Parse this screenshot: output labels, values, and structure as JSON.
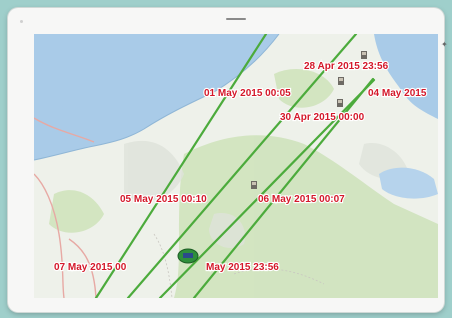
{
  "map": {
    "track_color": "#4cab3c",
    "label_color": "#d4182a",
    "water_color": "#a9cbe8",
    "land_color": "#eef1ea",
    "forest_color": "#c9dfb8",
    "labels": [
      "28 Apr 2015 23:56",
      "01 May 2015 00:05",
      "04 May 2015",
      "30 Apr 2015 00:00",
      "05 May 2015 00:10",
      "06 May 2015 00:07",
      "07 May 2015 00",
      "May 2015 23:56"
    ],
    "markers": [
      "waypoint-icon",
      "waypoint-icon",
      "waypoint-icon",
      "waypoint-icon",
      "boat-icon"
    ]
  }
}
